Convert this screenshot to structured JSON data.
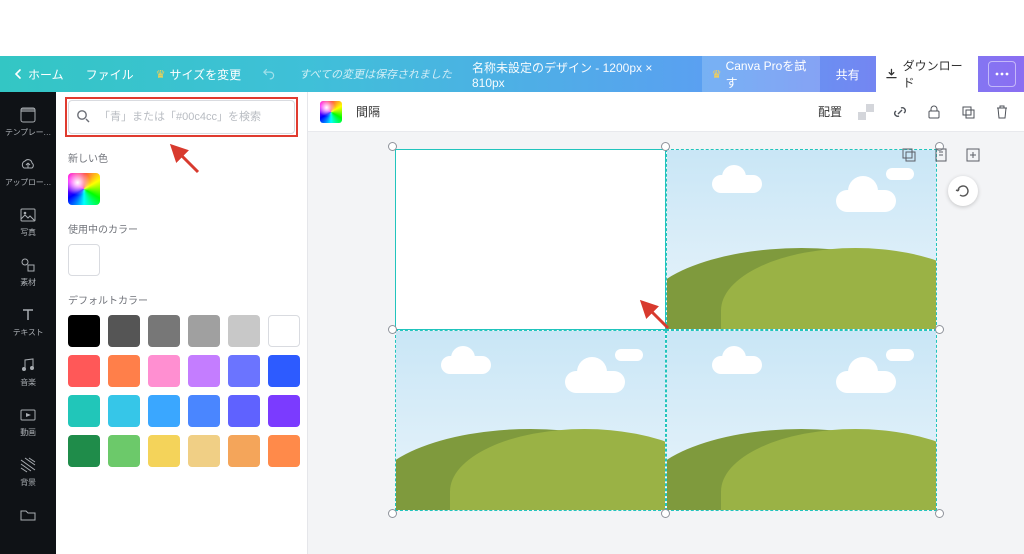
{
  "toolbar": {
    "home": "ホーム",
    "file": "ファイル",
    "resize": "サイズを変更",
    "status": "すべての変更は保存されました",
    "title": "名称未設定のデザイン - 1200px × 810px",
    "try_pro": "Canva Proを試す",
    "share": "共有",
    "download": "ダウンロード"
  },
  "rail": {
    "template": "テンプレー…",
    "upload": "アップロー…",
    "photo": "写真",
    "element": "素材",
    "text": "テキスト",
    "music": "音楽",
    "video": "動画",
    "background": "背景",
    "folder": "フォルダー"
  },
  "panel": {
    "search_placeholder": "「青」または「#00c4cc」を検索",
    "new_color": "新しい色",
    "used_colors": "使用中のカラー",
    "default_colors": "デフォルトカラー",
    "used": [
      "#ffffff"
    ],
    "defaults": [
      "#000000",
      "#555555",
      "#777777",
      "#a0a0a0",
      "#c8c8c8",
      "#ffffff",
      "#ff5858",
      "#ff7f4a",
      "#ff8fd1",
      "#c47dff",
      "#6b74ff",
      "#2d5bff",
      "#21c6b9",
      "#36c6e8",
      "#3aa7ff",
      "#4a86ff",
      "#5f62ff",
      "#7b3bff",
      "#1f8c4a",
      "#6cc96a",
      "#f4d35a",
      "#f0cf85",
      "#f4a55a",
      "#ff8a4a"
    ]
  },
  "canvas": {
    "spacing": "間隔",
    "position": "配置",
    "current_color": "rainbow"
  }
}
